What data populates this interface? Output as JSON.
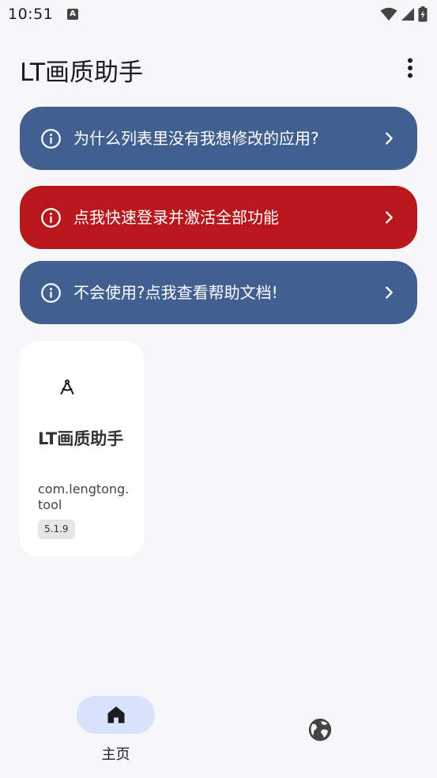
{
  "status_bar": {
    "time": "10:51",
    "notification_icon": "a-icon",
    "icons": [
      "wifi-icon",
      "signal-icon",
      "battery-icon"
    ]
  },
  "header": {
    "title": "LT画质助手",
    "menu_icon": "more-vert-icon"
  },
  "banners": [
    {
      "text": "为什么列表里没有我想修改的应用?",
      "color": "#42608f",
      "icon": "info-icon",
      "trail_icon": "chevron-right-icon"
    },
    {
      "text": "点我快速登录并激活全部功能",
      "color": "#b8181c",
      "icon": "info-icon",
      "trail_icon": "chevron-right-icon"
    },
    {
      "text": "不会使用?点我查看帮助文档!",
      "color": "#42608f",
      "icon": "info-icon",
      "trail_icon": "chevron-right-icon"
    }
  ],
  "app_card": {
    "icon": "compass-icon",
    "name": "LT画质助手",
    "package": "com.lengtong.tool",
    "version": "5.1.9"
  },
  "bottom_nav": {
    "items": [
      {
        "label": "主页",
        "icon": "home-icon",
        "selected": true
      },
      {
        "label": "",
        "icon": "globe-icon",
        "selected": false
      }
    ]
  }
}
